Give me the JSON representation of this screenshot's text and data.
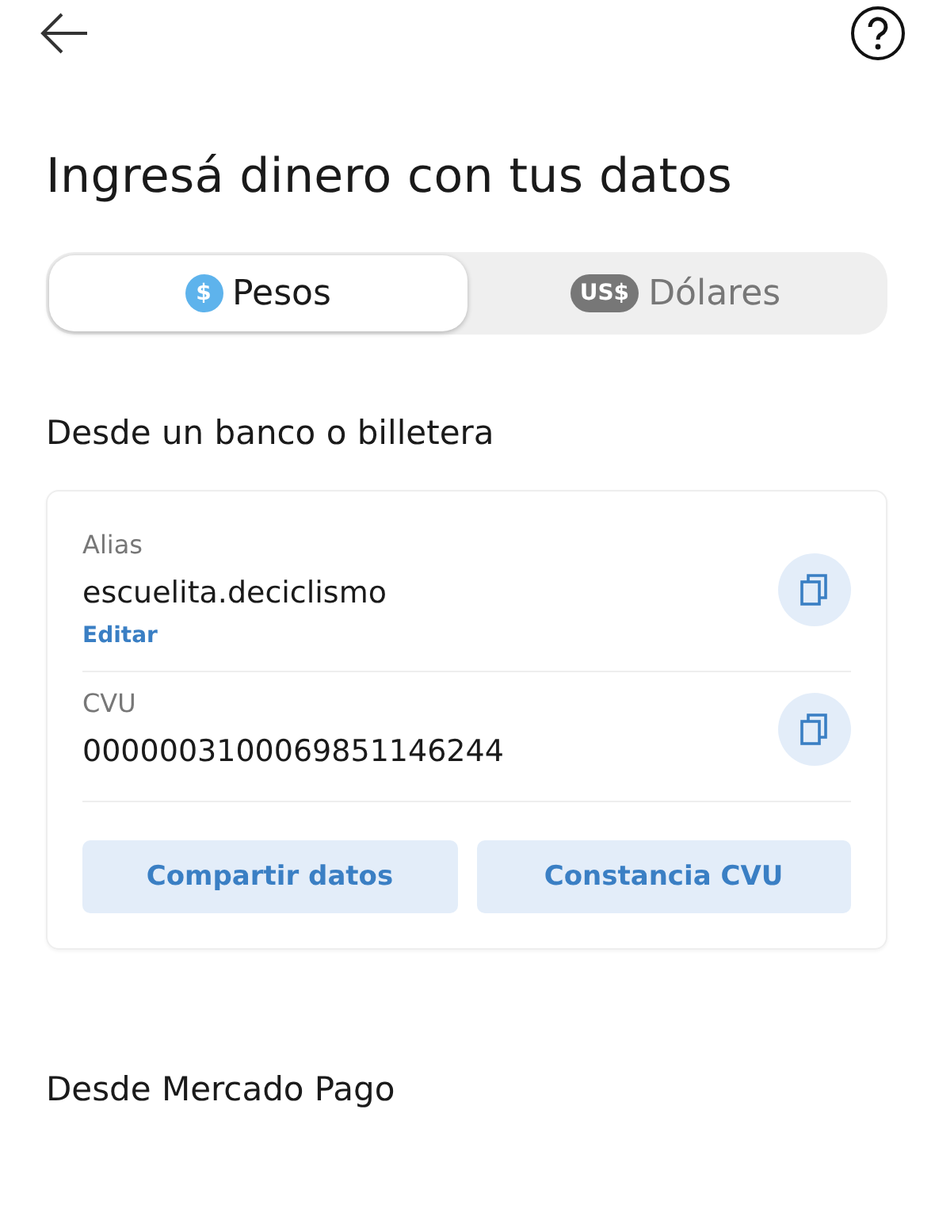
{
  "title": "Ingresá dinero con tus datos",
  "tabs": [
    {
      "badge": "$",
      "label": "Pesos",
      "selected": true
    },
    {
      "badge": "US$",
      "label": "Dólares",
      "selected": false
    }
  ],
  "bank_section": {
    "title": "Desde un banco o billetera",
    "fields": [
      {
        "label": "Alias",
        "value": "escuelita.deciclismo",
        "link": "Editar"
      },
      {
        "label": "CVU",
        "value": "0000003100069851146244"
      }
    ],
    "buttons": [
      "Compartir datos",
      "Constancia CVU"
    ]
  },
  "mp_section": {
    "title": "Desde Mercado Pago"
  }
}
